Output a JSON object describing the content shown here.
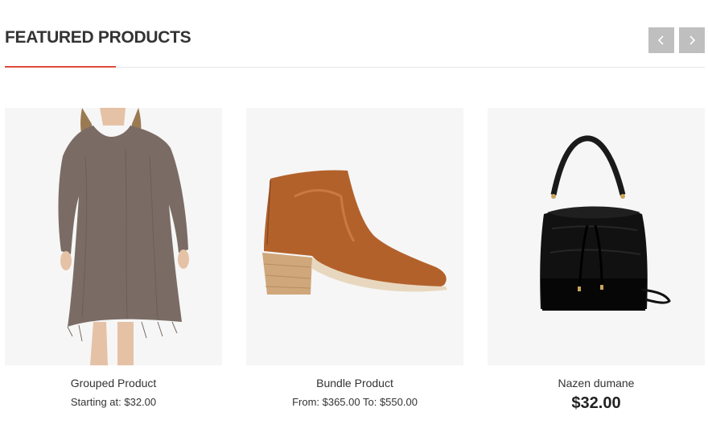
{
  "section": {
    "title": "FEATURED PRODUCTS",
    "accent_color": "#e04b3b",
    "prev_icon": "chevron-left-icon",
    "next_icon": "chevron-right-icon"
  },
  "products": [
    {
      "name": "Grouped Product",
      "price_text": "Starting at: $32.00",
      "image": "dress-image"
    },
    {
      "name": "Bundle Product",
      "price_text": "From: $365.00 To: $550.00",
      "image": "ankle-boot-image"
    },
    {
      "name": "Nazen dumane",
      "price_text": "$32.00",
      "image": "black-bucket-bag-image"
    }
  ]
}
